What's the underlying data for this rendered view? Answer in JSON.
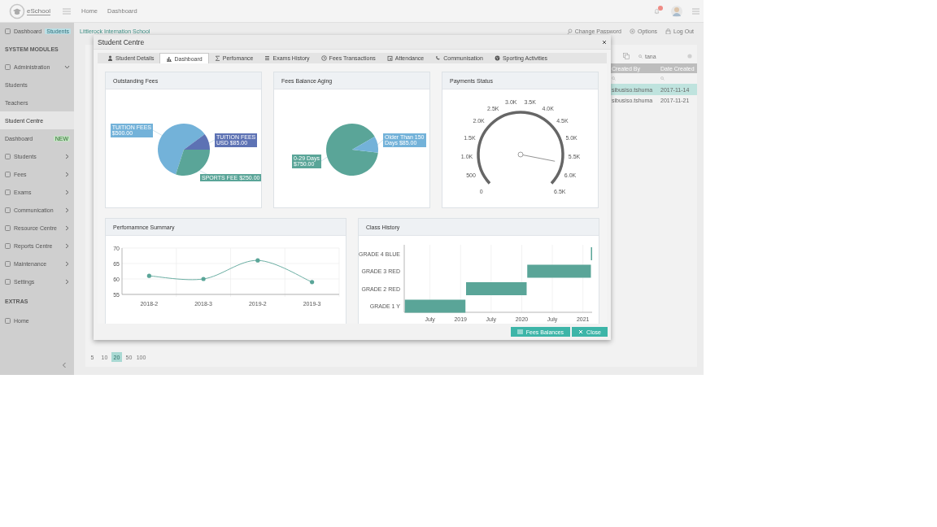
{
  "header": {
    "logo": "eSchool",
    "nav": [
      "Home",
      "Dashboard"
    ]
  },
  "sidebar": {
    "items": [
      {
        "kind": "link",
        "label": "Dashboard",
        "badge": "Students",
        "selected": false
      },
      {
        "kind": "heading",
        "label": "SYSTEM MODULES"
      },
      {
        "kind": "group",
        "label": "Administration",
        "expanded": true,
        "selected": false
      },
      {
        "kind": "sub",
        "label": "Students",
        "selected": false
      },
      {
        "kind": "sub",
        "label": "Teachers",
        "selected": false
      },
      {
        "kind": "sub",
        "label": "Student Centre",
        "selected": true
      },
      {
        "kind": "sub",
        "label": "Dashboard",
        "badge": "NEW",
        "selected": false
      },
      {
        "kind": "group",
        "label": "Students",
        "expanded": false,
        "selected": false
      },
      {
        "kind": "group",
        "label": "Fees",
        "expanded": false,
        "selected": false
      },
      {
        "kind": "group",
        "label": "Exams",
        "expanded": false,
        "selected": false
      },
      {
        "kind": "group",
        "label": "Communication",
        "expanded": false,
        "selected": false
      },
      {
        "kind": "group",
        "label": "Resource Centre",
        "expanded": false,
        "selected": false
      },
      {
        "kind": "group",
        "label": "Reports Centre",
        "expanded": false,
        "selected": false
      },
      {
        "kind": "group",
        "label": "Maintenance",
        "expanded": false,
        "selected": false
      },
      {
        "kind": "group",
        "label": "Settings",
        "expanded": false,
        "selected": false
      },
      {
        "kind": "heading",
        "label": "EXTRAS"
      },
      {
        "kind": "link",
        "label": "Home",
        "selected": false
      }
    ]
  },
  "breadcrumb": "Littlerock Internation School",
  "top_links": [
    "Change Password",
    "Options",
    "Log Out"
  ],
  "table": {
    "search": "tana",
    "columns": [
      "Created By",
      "Date Created"
    ],
    "rows": [
      {
        "cells": [
          "sibusiso.tshuma",
          "2017-11-14"
        ],
        "selected": true
      },
      {
        "cells": [
          "sibusiso.tshuma",
          "2017-11-21"
        ],
        "selected": false
      }
    ]
  },
  "pagination": [
    {
      "label": "5",
      "selected": false
    },
    {
      "label": "10",
      "selected": false
    },
    {
      "label": "20",
      "selected": true
    },
    {
      "label": "50",
      "selected": false
    },
    {
      "label": "100",
      "selected": false
    }
  ],
  "modal": {
    "title": "Student Centre",
    "tabs": [
      {
        "kind": "user",
        "label": "Student Details",
        "selected": false
      },
      {
        "kind": "chart",
        "label": "Dashboard",
        "selected": true
      },
      {
        "kind": "sigma",
        "label": "Perfomance",
        "selected": false
      },
      {
        "kind": "list",
        "label": "Exams History",
        "selected": false
      },
      {
        "kind": "clock",
        "label": "Fees Transactions",
        "selected": false
      },
      {
        "kind": "calendar",
        "label": "Attendance",
        "selected": false
      },
      {
        "kind": "phone",
        "label": "Communisation",
        "selected": false
      },
      {
        "kind": "globe",
        "label": "Sporting Activities",
        "selected": false
      }
    ],
    "panels": [
      {
        "kind": "pie",
        "title": "Outstanding Fees",
        "chart_data": {
          "type": "pie",
          "categories": [
            "TUITION FEES\n$500.00",
            "TUITION FEES\nUSD $85.00",
            "SPORTS FEE $250.00"
          ],
          "values": [
            500,
            85,
            250
          ],
          "colors": [
            "#73b2d9",
            "#5d72b4",
            "#5aa598"
          ]
        }
      },
      {
        "kind": "pie",
        "title": "Fees Balance Aging",
        "chart_data": {
          "type": "pie",
          "categories": [
            "0-29 Days\n$750.00",
            "Older Than 150\nDays $85.00"
          ],
          "values": [
            750,
            85
          ],
          "colors": [
            "#5aa598",
            "#73b2d9"
          ]
        }
      },
      {
        "kind": "gauge",
        "title": "Payments Status",
        "ticks": [
          "0",
          "500",
          "1.0K",
          "1.5K",
          "2.0K",
          "2.5K",
          "3.0K",
          "3.5K",
          "4.0K",
          "4.5K",
          "5.0K",
          "5.5K",
          "6.0K",
          "6.5K"
        ],
        "level": 0.88
      },
      {
        "kind": "line",
        "title": "Perfomamnce Summary",
        "chart_data": {
          "type": "line",
          "categories": [
            "2018-2",
            "2018-3",
            "2019-2",
            "2019-3"
          ],
          "series": [
            {
              "color": "#5aa598",
              "values": [
                61,
                60,
                66,
                59
              ]
            }
          ],
          "ylim": [
            55,
            70
          ],
          "yticks": [
            55,
            60,
            65,
            70
          ]
        }
      },
      {
        "kind": "timeline",
        "title": "Class History",
        "rows": [
          "GRADE 4 BLUE",
          "GRADE 3 RED",
          "GRADE 2 RED",
          "GRADE 1 Y"
        ],
        "axis_labels": [
          "July",
          "2019",
          "July",
          "2020",
          "July",
          "2021"
        ]
      }
    ],
    "buttons": [
      {
        "kind": "list",
        "label": "Fees Balances"
      },
      {
        "kind": "close",
        "label": "Close"
      }
    ]
  }
}
